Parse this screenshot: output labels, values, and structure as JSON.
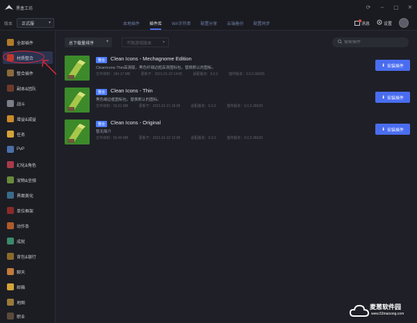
{
  "app": {
    "title": "黑盒工坊"
  },
  "version": {
    "label": "版本",
    "selected": "正式服"
  },
  "tabs": [
    {
      "label": "本地插件",
      "active": false
    },
    {
      "label": "插件库",
      "active": true
    },
    {
      "label": "WA字符串",
      "active": false
    },
    {
      "label": "配置分享",
      "active": false
    },
    {
      "label": "云端备份",
      "active": false
    },
    {
      "label": "配置同步",
      "active": false
    }
  ],
  "header": {
    "messages_label": "消息",
    "settings_label": "设置"
  },
  "sidebar": {
    "items": [
      {
        "label": "全部插件",
        "icon": "wow-logo-icon",
        "color": "#b07a2a"
      },
      {
        "label": "材质整合",
        "icon": "texture-icon",
        "color": "#c0392b",
        "active": true
      },
      {
        "label": "整合插件",
        "icon": "bundle-icon",
        "color": "#8a6a3a"
      },
      {
        "label": "副本&团队",
        "icon": "dungeon-icon",
        "color": "#6c3a2a"
      },
      {
        "label": "战斗",
        "icon": "combat-icon",
        "color": "#7a7f88"
      },
      {
        "label": "增益&减益",
        "icon": "buff-icon",
        "color": "#c98a2a"
      },
      {
        "label": "任务",
        "icon": "quest-icon",
        "color": "#d4a437"
      },
      {
        "label": "PvP",
        "icon": "pvp-icon",
        "color": "#4a6fa8"
      },
      {
        "label": "幻化&角色",
        "icon": "transmog-icon",
        "color": "#a83a4a"
      },
      {
        "label": "宠物&坐骑",
        "icon": "pet-icon",
        "color": "#6a8a3a"
      },
      {
        "label": "界面美化",
        "icon": "ui-icon",
        "color": "#3a6a8a"
      },
      {
        "label": "单位框架",
        "icon": "unit-frame-icon",
        "color": "#8a2a2a"
      },
      {
        "label": "动作条",
        "icon": "action-bar-icon",
        "color": "#b05a2a"
      },
      {
        "label": "成就",
        "icon": "achievement-icon",
        "color": "#3a8a6a"
      },
      {
        "label": "背包&银行",
        "icon": "bag-icon",
        "color": "#8a6a2a"
      },
      {
        "label": "聊天",
        "icon": "chat-icon",
        "color": "#c07a3a"
      },
      {
        "label": "邮箱",
        "icon": "mail-icon",
        "color": "#d4a437"
      },
      {
        "label": "地图",
        "icon": "map-icon",
        "color": "#9a7a3a"
      },
      {
        "label": "职业",
        "icon": "class-icon",
        "color": "#5a4a3a"
      }
    ]
  },
  "toolbar": {
    "sort_label": "总下载量排序",
    "filter_placeholder": "不限游戏版本",
    "search_placeholder": "搜索插件"
  },
  "plugins": [
    {
      "badge": "整合",
      "name": "Clean Icons - Mechagnome Edition",
      "desc": "CleanIcons-Thin高清版，黑色纤细边框高清图标包，替换默认的图标。",
      "size": "文件体积：184.17 MB",
      "updated": "更新于：2021-01-22 14:00",
      "version": "适配版本：9.0.2",
      "file_version": "插件版本：9.0.2-36665",
      "install_label": "安装插件"
    },
    {
      "badge": "整合",
      "name": "Clean Icons - Thin",
      "desc": "黑色细边框图标包，替换默认的图标。",
      "size": "文件体积：53.61 MB",
      "updated": "更新于：2021-01-21 18:09",
      "version": "适配版本：9.0.2",
      "file_version": "插件版本：9.0.2-36639",
      "install_label": "安装插件"
    },
    {
      "badge": "整合",
      "name": "Clean Icons - Original",
      "desc": "暂无简介",
      "size": "文件体积：50.49 MB",
      "updated": "更新于：2021-01-22 12:09",
      "version": "适配版本：9.0.2",
      "file_version": "插件版本：9.0.2-36639",
      "install_label": "安装插件"
    }
  ],
  "watermark": {
    "title": "麦葱软件园",
    "url": "www.52maicong.com"
  },
  "colors": {
    "accent": "#4a6df0",
    "active_tab_underline": "#4e6cf0",
    "annotation": "#e0283a"
  }
}
